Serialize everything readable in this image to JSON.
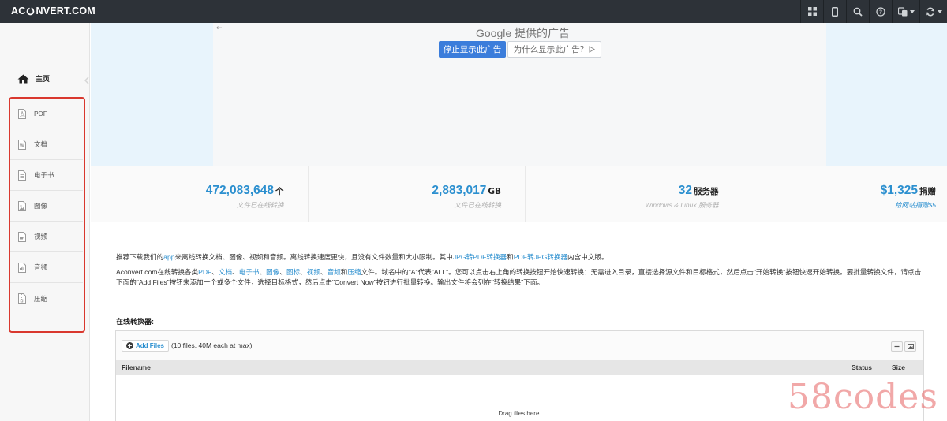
{
  "navbar": {
    "brand_pre": "AC",
    "brand_post": "NVERT.COM",
    "icons": [
      "grid-icon",
      "mobile-icon",
      "search-icon",
      "help-icon",
      "language-icon",
      "refresh-icon"
    ]
  },
  "sidebar": {
    "home_label": "主页",
    "categories": [
      {
        "label": "PDF",
        "icon": "pdf-icon"
      },
      {
        "label": "文档",
        "icon": "document-icon"
      },
      {
        "label": "电子书",
        "icon": "ebook-icon"
      },
      {
        "label": "图像",
        "icon": "image-icon"
      },
      {
        "label": "视频",
        "icon": "video-icon"
      },
      {
        "label": "音频",
        "icon": "audio-icon"
      },
      {
        "label": "压缩",
        "icon": "archive-icon"
      }
    ]
  },
  "ad": {
    "back_glyph": "←",
    "title": "Google 提供的广告",
    "stop_label": "停止显示此广告",
    "why_label": "为什么显示此广告?"
  },
  "stats": [
    {
      "number": "472,083,648",
      "unit": "个",
      "sub": "文件已在线转换"
    },
    {
      "number": "2,883,017",
      "unit": "GB",
      "sub": "文件已在线转换"
    },
    {
      "number": "32",
      "unit": "服务器",
      "sub": "Windows & Linux 服务器"
    },
    {
      "number": "$1,325",
      "unit": "捐赠",
      "sub": "给网站捐赠$5"
    }
  ],
  "intro": {
    "p1_a": "推荐下载我们的",
    "p1_link1": "app",
    "p1_b": "来离线转换文档、图像、视频和音频。离线转换速度更快，且没有文件数量和大小限制。其中",
    "p1_link2": "JPG转PDF转换器",
    "p1_c": "和",
    "p1_link3": "PDF转JPG转换器",
    "p1_d": "内含中文版。",
    "p2_a": "Aconvert.com在线转换各类",
    "p2_links": [
      "PDF",
      "文档",
      "电子书",
      "图像",
      "图标",
      "视频",
      "音频"
    ],
    "p2_b": "和",
    "p2_link_last": "压缩",
    "p2_c": "文件。域名中的\"A\"代表\"ALL\"。您可以点击右上角的转换按钮开始快速转换：无需进入目录，直接选择源文件和目标格式，然后点击\"开始转换\"按钮快速开始转换。要批量转换文件，请点击下面的\"Add Files\"按钮来添加一个或多个文件，选择目标格式，然后点击\"Convert Now\"按钮进行批量转换。输出文件将会列在\"转换结果\"下面。"
  },
  "converter": {
    "section_title": "在线转换器:",
    "add_files_label": "Add Files",
    "limit_note": "(10 files, 40M each at max)",
    "columns": {
      "filename": "Filename",
      "status": "Status",
      "size": "Size"
    },
    "drag_text": "Drag files here."
  },
  "watermark": "58codes",
  "colors": {
    "navbar": "#2d3238",
    "accent": "#2b8fcf",
    "highlight_box": "#d9382e",
    "ad_bg": "#e8f4fc"
  }
}
